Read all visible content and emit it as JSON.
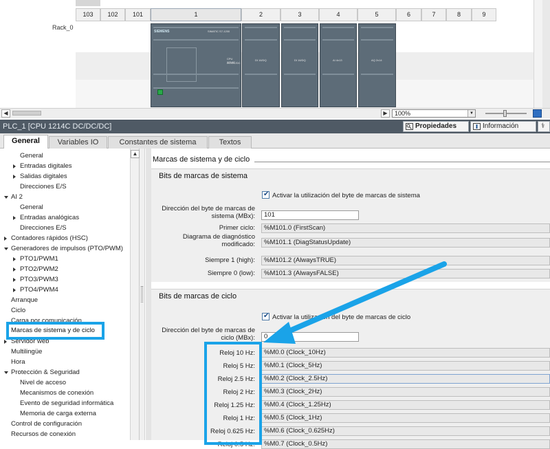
{
  "rack": {
    "row_label": "Rack_0",
    "slots": [
      "103",
      "102",
      "101",
      "1",
      "2",
      "3",
      "4",
      "5",
      "6",
      "7",
      "8",
      "9"
    ],
    "zoom": "100%"
  },
  "properties": {
    "title": "PLC_1 [CPU 1214C DC/DC/DC]",
    "panel_tabs": [
      "Propiedades",
      "Información"
    ],
    "tabs": [
      "General",
      "Variables IO",
      "Constantes de sistema",
      "Textos"
    ]
  },
  "nav": {
    "items": [
      {
        "label": "General",
        "indent": 2,
        "arrow": ""
      },
      {
        "label": "Entradas digitales",
        "indent": 2,
        "arrow": "right"
      },
      {
        "label": "Salidas digitales",
        "indent": 2,
        "arrow": "right"
      },
      {
        "label": "Direcciones E/S",
        "indent": 2,
        "arrow": ""
      },
      {
        "label": "AI 2",
        "indent": 1,
        "arrow": "down"
      },
      {
        "label": "General",
        "indent": 2,
        "arrow": ""
      },
      {
        "label": "Entradas analógicas",
        "indent": 2,
        "arrow": "right"
      },
      {
        "label": "Direcciones E/S",
        "indent": 2,
        "arrow": ""
      },
      {
        "label": "Contadores rápidos (HSC)",
        "indent": 1,
        "arrow": "right"
      },
      {
        "label": "Generadores de impulsos (PTO/PWM)",
        "indent": 1,
        "arrow": "down"
      },
      {
        "label": "PTO1/PWM1",
        "indent": 2,
        "arrow": "right"
      },
      {
        "label": "PTO2/PWM2",
        "indent": 2,
        "arrow": "right"
      },
      {
        "label": "PTO3/PWM3",
        "indent": 2,
        "arrow": "right"
      },
      {
        "label": "PTO4/PWM4",
        "indent": 2,
        "arrow": "right"
      },
      {
        "label": "Arranque",
        "indent": 1,
        "arrow": ""
      },
      {
        "label": "Ciclo",
        "indent": 1,
        "arrow": ""
      },
      {
        "label": "Carga por comunicación",
        "indent": 1,
        "arrow": ""
      },
      {
        "label": "Marcas de sistema y de ciclo",
        "indent": 1,
        "arrow": ""
      },
      {
        "label": "Servidor web",
        "indent": 1,
        "arrow": "right"
      },
      {
        "label": "Multilingüe",
        "indent": 1,
        "arrow": ""
      },
      {
        "label": "Hora",
        "indent": 1,
        "arrow": ""
      },
      {
        "label": "Protección & Seguridad",
        "indent": 1,
        "arrow": "down"
      },
      {
        "label": "Nivel de acceso",
        "indent": 2,
        "arrow": ""
      },
      {
        "label": "Mecanismos de conexión",
        "indent": 2,
        "arrow": ""
      },
      {
        "label": "Evento de seguridad informática",
        "indent": 2,
        "arrow": ""
      },
      {
        "label": "Memoria de carga externa",
        "indent": 2,
        "arrow": ""
      },
      {
        "label": "Control de configuración",
        "indent": 1,
        "arrow": ""
      },
      {
        "label": "Recursos de conexión",
        "indent": 1,
        "arrow": ""
      }
    ],
    "selected_label": "Marcas de sistema y de ciclo"
  },
  "content": {
    "section_title": "Marcas de sistema y de ciclo",
    "system_bits": {
      "title": "Bits de marcas de sistema",
      "enable_label": "Activar la utilización del byte de marcas de sistema",
      "address_label": "Dirección del byte de marcas de sistema (MBx):",
      "address_value": "101",
      "rows": [
        {
          "label": "Primer ciclo:",
          "value": "%M101.0 (FirstScan)"
        },
        {
          "label": "Diagrama de diagnóstico modificado:",
          "value": "%M101.1 (DiagStatusUpdate)"
        },
        {
          "label": "Siempre 1 (high):",
          "value": "%M101.2 (AlwaysTRUE)"
        },
        {
          "label": "Siempre 0 (low):",
          "value": "%M101.3 (AlwaysFALSE)"
        }
      ]
    },
    "clock_bits": {
      "title": "Bits de marcas de ciclo",
      "enable_label": "Activar la utilización del byte de marcas de ciclo",
      "address_label": "Dirección del byte de marcas de ciclo (MBx):",
      "address_value": "0",
      "rows": [
        {
          "label": "Reloj 10 Hz:",
          "value": "%M0.0 (Clock_10Hz)"
        },
        {
          "label": "Reloj 5 Hz:",
          "value": "%M0.1 (Clock_5Hz)"
        },
        {
          "label": "Reloj 2.5 Hz:",
          "value": "%M0.2 (Clock_2.5Hz)"
        },
        {
          "label": "Reloj 2 Hz:",
          "value": "%M0.3 (Clock_2Hz)"
        },
        {
          "label": "Reloj 1.25 Hz:",
          "value": "%M0.4 (Clock_1.25Hz)"
        },
        {
          "label": "Reloj 1 Hz:",
          "value": "%M0.5 (Clock_1Hz)"
        },
        {
          "label": "Reloj 0.625 Hz:",
          "value": "%M0.6 (Clock_0.625Hz)"
        },
        {
          "label": "Reloj 0.5 Hz:",
          "value": "%M0.7 (Clock_0.5Hz)"
        }
      ]
    }
  },
  "colors": {
    "highlight": "#1aa3e8",
    "title_bar": "#4f5a65",
    "module": "#5d6c78"
  }
}
